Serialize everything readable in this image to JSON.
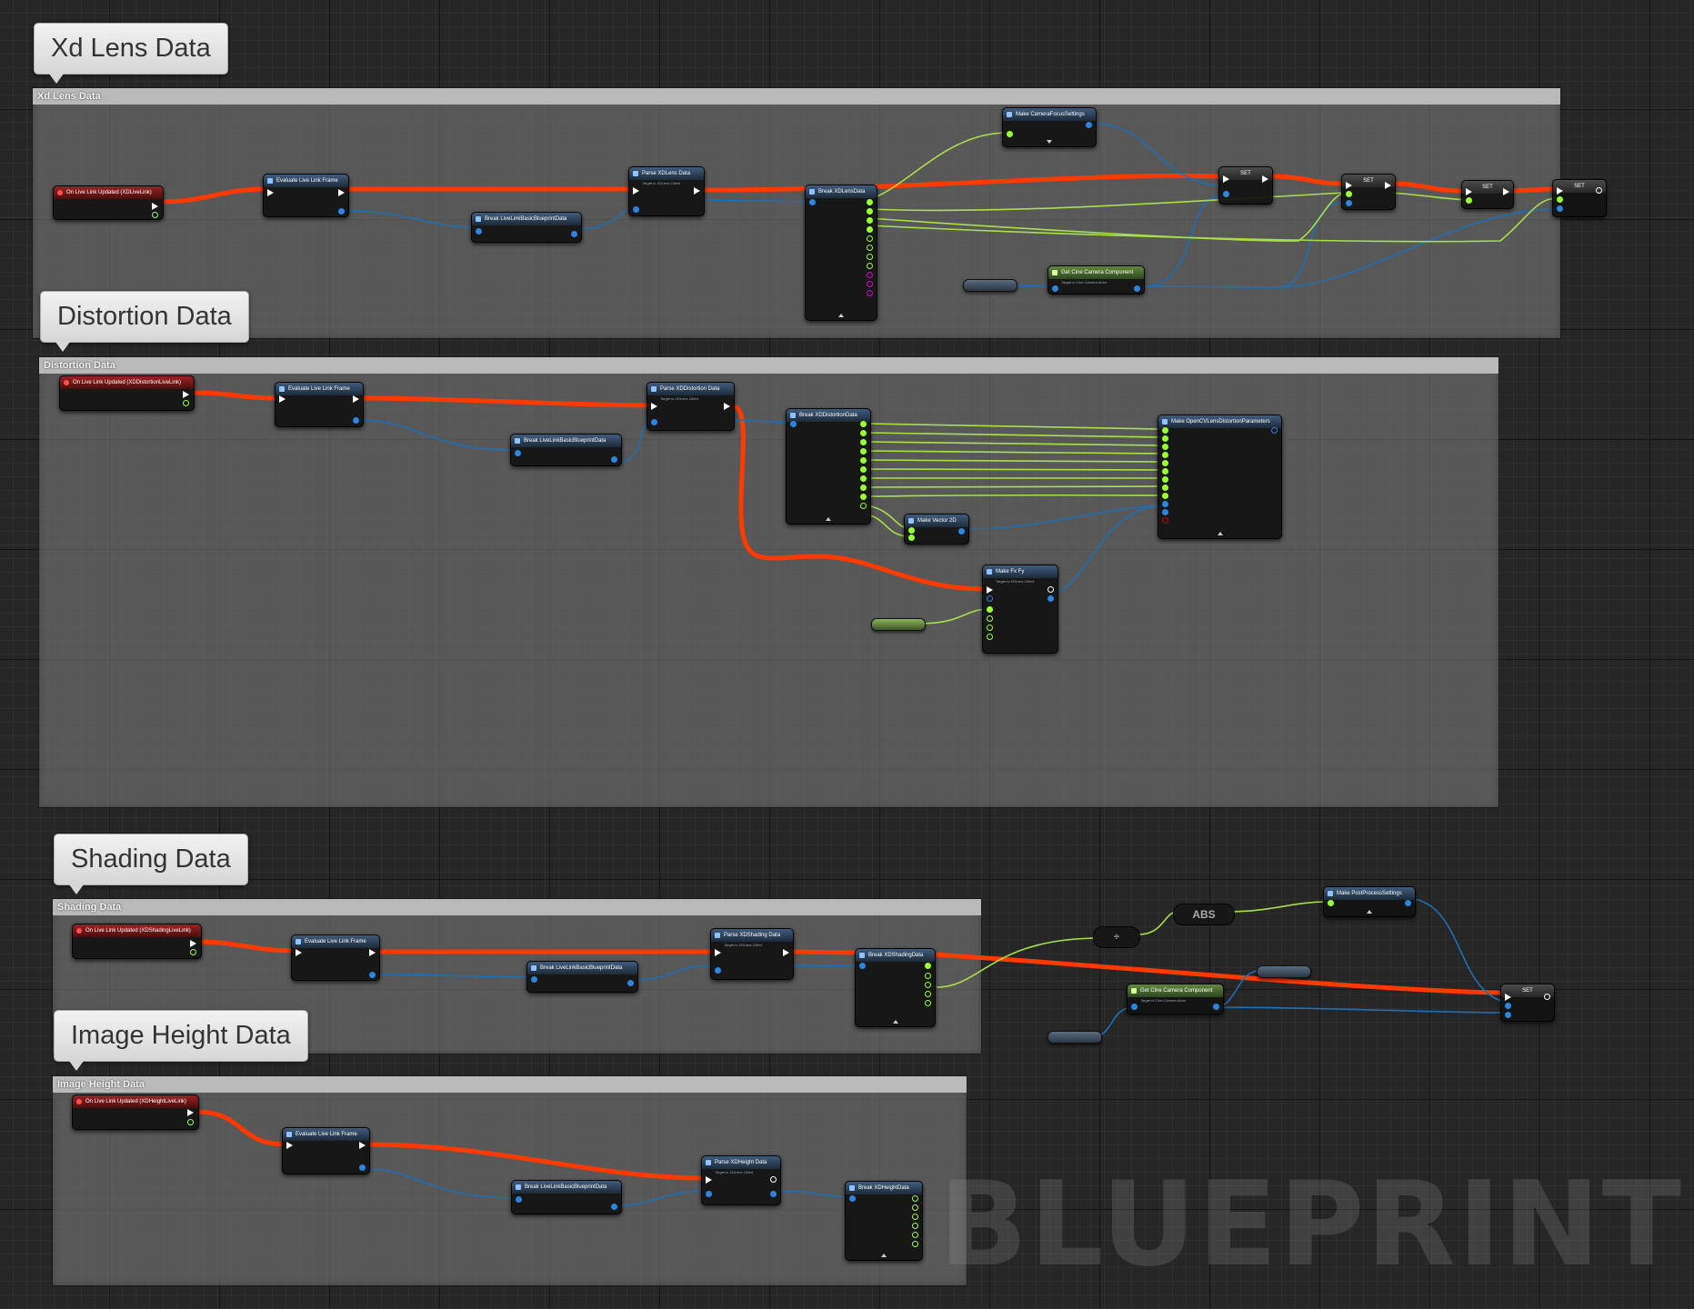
{
  "watermark": "BLUEPRINT",
  "colors": {
    "exec_wire": "#ff3a00",
    "object_wire": "#1f6fb4",
    "float_wire": "#a8e04a",
    "event_header": "#9a2222",
    "function_header": "#3f5c7d",
    "getter_header": "#5f8a3c"
  },
  "comments": {
    "xd_lens": {
      "bubble": "Xd Lens Data",
      "header": "Xd Lens Data"
    },
    "distortion": {
      "bubble": "Distortion Data",
      "header": "Distortion Data"
    },
    "shading": {
      "bubble": "Shading Data",
      "header": "Shading Data"
    },
    "image_height": {
      "bubble": "Image Height Data",
      "header": "Image Height Data"
    }
  },
  "nodes": {
    "lens_event": "On Live Link Updated (XDLiveLink)",
    "lens_eval": "Evaluate Live Link Frame",
    "lens_break_basic": "Break LiveLinkBasicBlueprintData",
    "lens_parse": "Parse XDLens Data",
    "lens_parse_sub": "Target is XDLens Client",
    "lens_break": "Break XDLensData",
    "lens_make_focus": "Make CameraFocusSettings",
    "lens_get_camera": "Get Cine Camera Component",
    "lens_get_camera_sub": "Target is Cine Camera Actor",
    "set": "SET",
    "dist_event": "On Live Link Updated (XDDistortionLiveLink)",
    "dist_eval": "Evaluate Live Link Frame",
    "dist_break_basic": "Break LiveLinkBasicBlueprintData",
    "dist_parse": "Parse XDDistortion Data",
    "dist_parse_sub": "Target is XDLens Client",
    "dist_break": "Break XDDistortionData",
    "dist_make_opencv": "Make OpenCVLensDistortionParameters",
    "dist_make_vector": "Make Vector 2D",
    "dist_make_fxfy": "Make Fx Fy",
    "dist_make_fxfy_sub": "Target is XDLens Client",
    "shade_event": "On Live Link Updated (XDShadingLiveLink)",
    "shade_eval": "Evaluate Live Link Frame",
    "shade_break_basic": "Break LiveLinkBasicBlueprintData",
    "shade_parse": "Parse XDShading Data",
    "shade_parse_sub": "Target is XDLens Client",
    "shade_break": "Break XDShadingData",
    "shade_abs": "ABS",
    "shade_divide": "÷",
    "shade_make_post": "Make PostProcessSettings",
    "shade_get_camera": "Get Cine Camera Component",
    "shade_get_camera_sub": "Target is Cine Camera Actor",
    "img_event": "On Live Link Updated (XDHeightLiveLink)",
    "img_eval": "Evaluate Live Link Frame",
    "img_break_basic": "Break LiveLinkBasicBlueprintData",
    "img_parse": "Parse XDHeight Data",
    "img_parse_sub": "Target is XDLens Client",
    "img_break": "Break XDHeightData"
  }
}
